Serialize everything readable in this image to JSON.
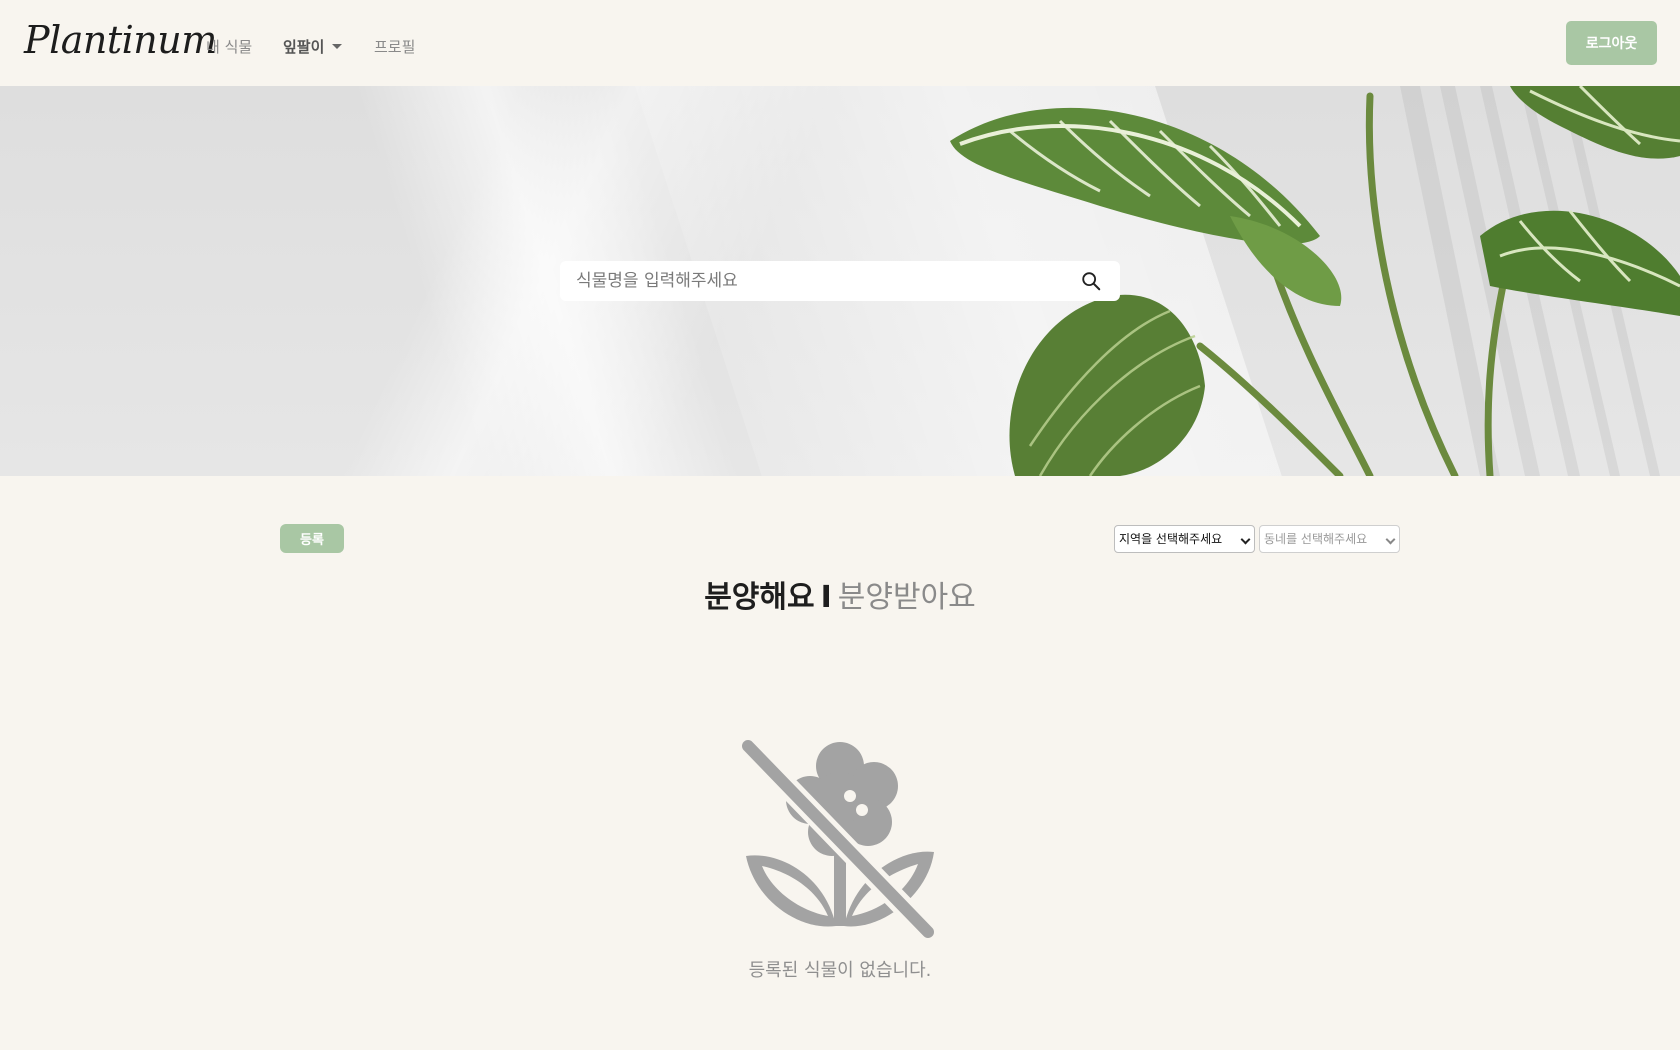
{
  "navbar": {
    "brand": "Plantinum",
    "links": [
      {
        "label": "내 식물"
      },
      {
        "label": "잎팔이"
      },
      {
        "label": "프로필"
      }
    ],
    "logout_label": "로그아웃"
  },
  "hero": {
    "search": {
      "placeholder": "식물명을 입력해주세요",
      "value": "",
      "icon": "search-icon"
    }
  },
  "toolbar": {
    "register_label": "등록",
    "region_select": {
      "selected": "지역을 선택해주세요"
    },
    "town_select": {
      "selected": "동네를 선택해주세요"
    }
  },
  "tabs": {
    "give": "분양해요",
    "separator": "I",
    "receive": "분양받아요"
  },
  "empty_state": {
    "icon": "no-flower-icon",
    "message": "등록된 식물이 없습니다."
  },
  "colors": {
    "background": "#f8f5ef",
    "accent": "#a9c7a4",
    "muted_text": "#8f8f8f"
  }
}
